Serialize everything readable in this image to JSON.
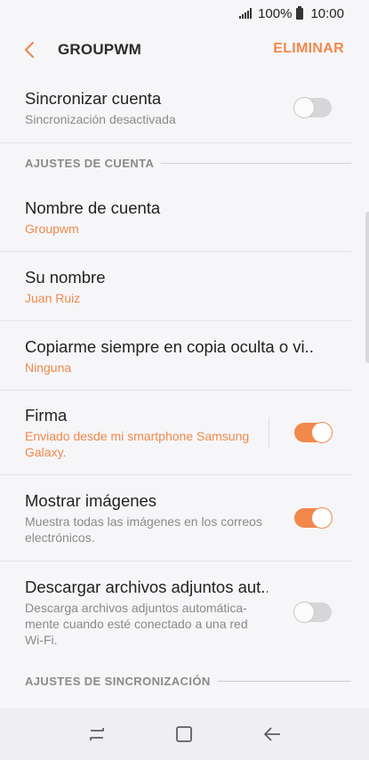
{
  "status_bar": {
    "battery": "100%",
    "time": "10:00"
  },
  "app_bar": {
    "title": "GROUPWM",
    "action": "ELIMINAR"
  },
  "settings": {
    "sync_account": {
      "title": "Sincronizar cuenta",
      "subtitle": "Sincronización desactivada",
      "enabled": false
    },
    "section_account": "AJUSTES DE CUENTA",
    "account_name": {
      "title": "Nombre de cuenta",
      "value": "Groupwm"
    },
    "your_name": {
      "title": "Su nombre",
      "value": "Juan Ruiz"
    },
    "bcc": {
      "title": "Copiarme siempre en copia oculta o vi..",
      "value": "Ninguna"
    },
    "signature": {
      "title": "Firma",
      "value": "Enviado desde mi smartphone Samsung Galaxy.",
      "enabled": true
    },
    "show_images": {
      "title": "Mostrar imágenes",
      "subtitle": "Muestra todas las imágenes en los correos electrónicos.",
      "enabled": true
    },
    "download_attachments": {
      "title": "Descargar archivos adjuntos aut..",
      "subtitle": "Descarga archivos adjuntos automática-mente cuando esté conectado a una red Wi-Fi.",
      "enabled": false
    },
    "section_sync": "AJUSTES DE SINCRONIZACIÓN"
  },
  "colors": {
    "accent": "#f1884c",
    "background": "#f6f6f8"
  }
}
